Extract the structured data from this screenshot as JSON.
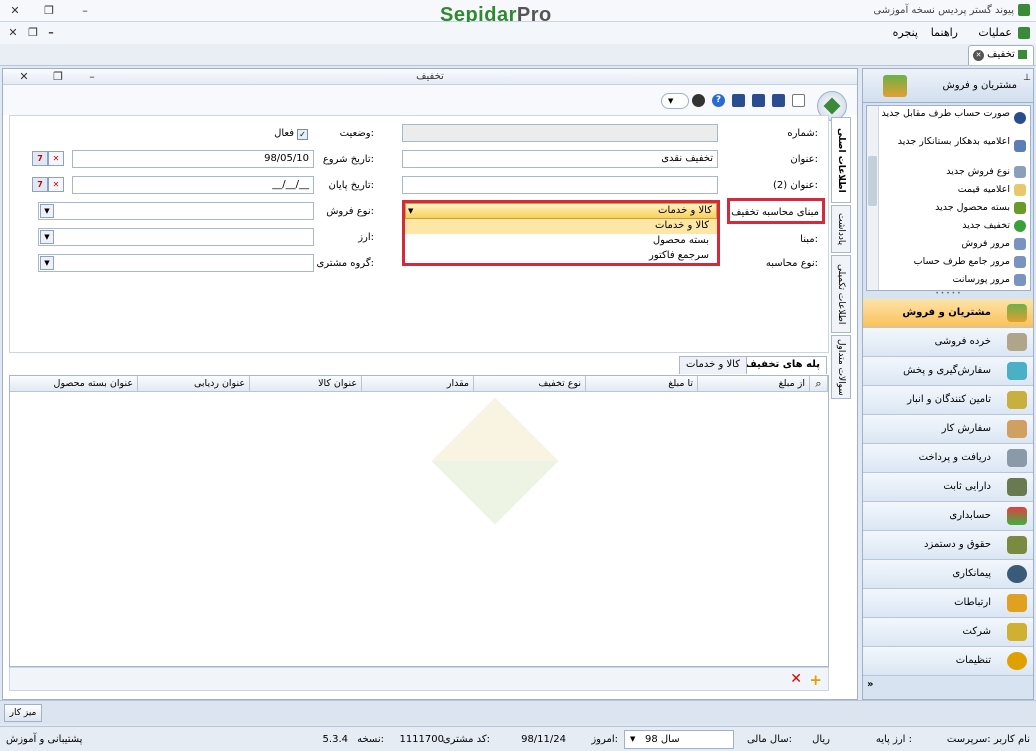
{
  "app": {
    "title": "پیوند گستر پردیس نسخه آموزشی",
    "logo_main": "Sepidar",
    "logo_suffix": "Pro"
  },
  "menu": {
    "items": [
      "عملیات",
      "راهنما",
      "پنجره"
    ]
  },
  "doc_tab": {
    "label": "تخفیف"
  },
  "form": {
    "title": "تخفیف",
    "fields": {
      "number_label": "شماره:",
      "title_label": "عنوان:",
      "title_value": "تخفیف نقدی",
      "title2_label": "عنوان (2):",
      "basis_label": "مبنای محاسبه تخفیف",
      "basis_value": "کالا و خدمات",
      "base_label": "مبنا:",
      "calc_type_label": "نوع محاسبه:",
      "status_label": "وضعیت:",
      "active_label": "فعال",
      "start_date_label": "تاریخ شروع:",
      "start_date_value": "98/05/10",
      "end_date_label": "تاریخ پایان:",
      "end_date_value": "__/__/__",
      "sale_type_label": "نوع فروش:",
      "currency_label": "ارز:",
      "customer_group_label": "گروه مشتری:"
    },
    "dropdown_options": [
      "کالا و خدمات",
      "بسته محصول",
      "سرجمع فاکتور"
    ],
    "vertical_tabs": [
      "اطلاعات اصلی",
      "یادداشت",
      "اطلاعات تکمیلی",
      "سوالات متداول"
    ],
    "grid_tabs": [
      "پله های تخفیف",
      "کالا و خدمات"
    ],
    "grid_headers": [
      "از مبلغ",
      "تا مبلغ",
      "نوع تخفیف",
      "مقدار",
      "عنوان کالا",
      "عنوان ردیابی",
      "عنوان بسته محصول"
    ]
  },
  "sidebar": {
    "header": "مشتریان و فروش",
    "quick_items": [
      "صورت حساب طرف مقابل جدید",
      "اعلامیه بدهکار بستانکار جدید",
      "نوع فروش جدید",
      "اعلامیه قیمت",
      "بسته محصول جدید",
      "تخفیف جدید",
      "مرور فروش",
      "مرور جامع طرف حساب",
      "مرور پورسانت"
    ],
    "modules": [
      "مشتریان و فروش",
      "خرده فروشی",
      "سفارش‌گیری و پخش",
      "تامین کنندگان و انبار",
      "سفارش کار",
      "دریافت و پرداخت",
      "دارایی ثابت",
      "حسابداری",
      "حقوق و دستمزد",
      "پیمانکاری",
      "ارتباطات",
      "شرکت",
      "تنظیمات"
    ]
  },
  "taskbar": {
    "desk_label": "میز کار"
  },
  "status": {
    "username": "نام کاربر :سرپرست",
    "base_currency": "ارز پایه :",
    "currency": "ریال",
    "fiscal_year_label": "سال مالی:",
    "fiscal_year": "سال 98",
    "today_label": "امروز:",
    "today": "98/11/24",
    "customer_code_label": "کد مشتری:",
    "customer_code": "1111700",
    "version_label": "نسخه:",
    "version": "5.3.4",
    "support": "پشتیبانی و آموزش"
  }
}
